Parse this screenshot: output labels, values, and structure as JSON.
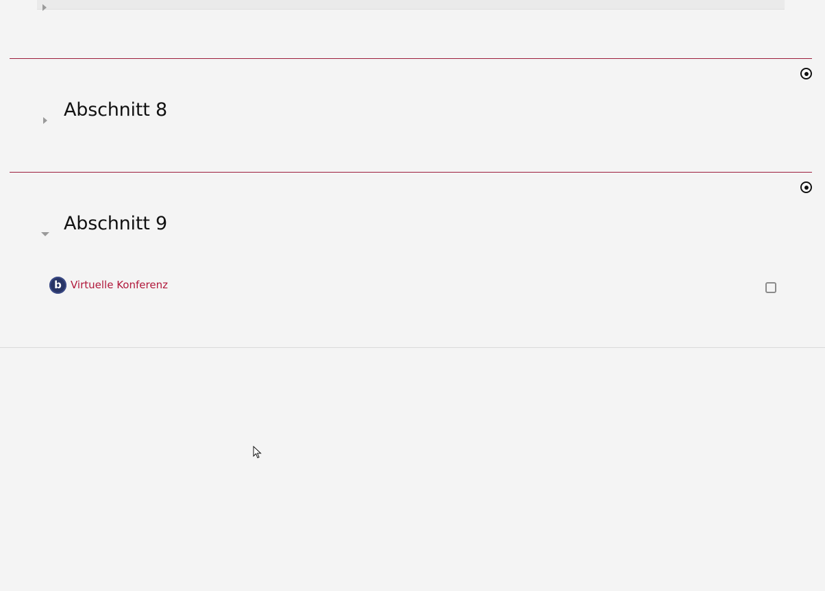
{
  "sections": [
    {
      "title": "Abschnitt 8",
      "state": "collapsed",
      "highlight_icon": "target-icon"
    },
    {
      "title": "Abschnitt 9",
      "state": "expanded",
      "highlight_icon": "target-icon"
    }
  ],
  "activities": [
    {
      "section": "Abschnitt 9",
      "icon": "bigbluebutton-icon",
      "icon_letter": "b",
      "label": "Virtuelle Konferenz",
      "completion": "unchecked"
    }
  ],
  "colors": {
    "accent": "#9b1b3a",
    "link": "#b0173a",
    "background": "#f4f4f4",
    "bbb_icon": "#283566"
  }
}
